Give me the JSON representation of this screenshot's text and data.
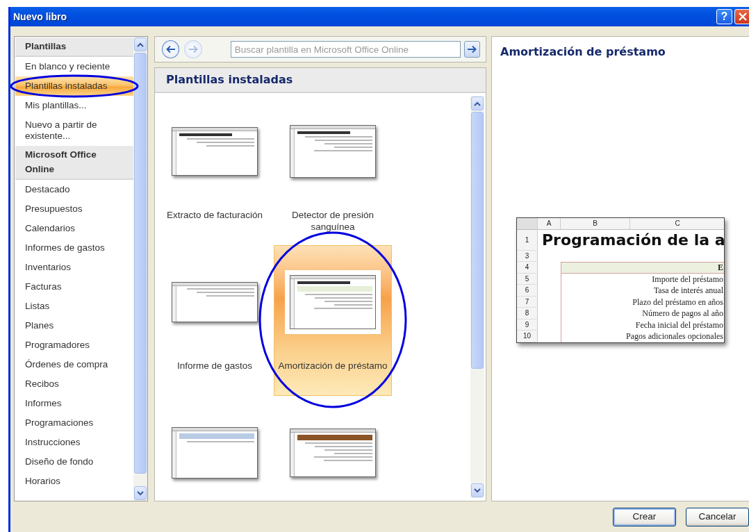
{
  "window": {
    "title": "Nuevo libro",
    "help_label": "?"
  },
  "sidebar": {
    "sections": [
      {
        "heading": "Plantillas",
        "items": [
          {
            "label": "En blanco y reciente",
            "selected": false
          },
          {
            "label": "Plantillas instaladas",
            "selected": true
          },
          {
            "label": "Mis plantillas...",
            "selected": false
          },
          {
            "label": "Nuevo a partir de existente...",
            "selected": false
          }
        ]
      },
      {
        "heading": "Microsoft Office Online",
        "items": [
          {
            "label": "Destacado",
            "selected": false
          },
          {
            "label": "Presupuestos",
            "selected": false
          },
          {
            "label": "Calendarios",
            "selected": false
          },
          {
            "label": "Informes de gastos",
            "selected": false
          },
          {
            "label": "Inventarios",
            "selected": false
          },
          {
            "label": "Facturas",
            "selected": false
          },
          {
            "label": "Listas",
            "selected": false
          },
          {
            "label": "Planes",
            "selected": false
          },
          {
            "label": "Programadores",
            "selected": false
          },
          {
            "label": "Órdenes de compra",
            "selected": false
          },
          {
            "label": "Recibos",
            "selected": false
          },
          {
            "label": "Informes",
            "selected": false
          },
          {
            "label": "Programaciones",
            "selected": false
          },
          {
            "label": "Instrucciones",
            "selected": false
          },
          {
            "label": "Diseño de fondo",
            "selected": false
          },
          {
            "label": "Horarios",
            "selected": false
          }
        ]
      }
    ]
  },
  "toolbar": {
    "nav_buttons": [
      {
        "kind": "back",
        "disabled": false
      },
      {
        "kind": "forward",
        "disabled": true
      }
    ],
    "search": {
      "placeholder": "Buscar plantilla en Microsoft Office Online"
    }
  },
  "gallery": {
    "title": "Plantillas instaladas",
    "templates": [
      {
        "name": "Extracto de facturación",
        "kind": "company",
        "selected": false
      },
      {
        "name": "Detector de presión sanguínea",
        "kind": "pressure",
        "selected": false
      },
      {
        "name": "Informe de gastos",
        "kind": "expense",
        "selected": false
      },
      {
        "name": "Amortización de préstamo",
        "kind": "loan",
        "selected": true
      },
      {
        "kind": "budget",
        "selected": false
      },
      {
        "kind": "list",
        "selected": false
      }
    ]
  },
  "preview": {
    "title": "Amortización de préstamo",
    "sheet": {
      "columns": [
        "A",
        "B",
        "C"
      ],
      "rows": [
        {
          "number": "1",
          "kind": "title",
          "text": "Programación de la a"
        },
        {
          "number": "3",
          "kind": "blank"
        },
        {
          "number": "4",
          "kind": "header",
          "text": "E"
        },
        {
          "number": "5",
          "kind": "label",
          "text": "Importe del préstamo"
        },
        {
          "number": "6",
          "kind": "label",
          "text": "Tasa de interés anual"
        },
        {
          "number": "7",
          "kind": "label",
          "text": "Plazo del préstamo en años"
        },
        {
          "number": "8",
          "kind": "label",
          "text": "Número de pagos al año"
        },
        {
          "number": "9",
          "kind": "label",
          "text": "Fecha inicial del préstamo"
        },
        {
          "number": "10",
          "kind": "label",
          "text": "Pagos adicionales opcionales"
        }
      ]
    }
  },
  "buttons": [
    {
      "label": "Crear",
      "default": true
    },
    {
      "label": "Cancelar",
      "default": false
    }
  ]
}
